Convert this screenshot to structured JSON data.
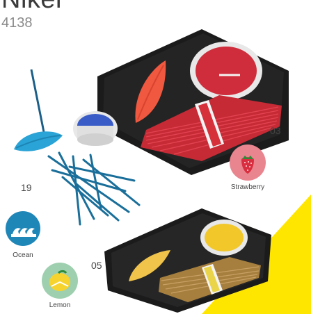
{
  "header": {
    "title": "Nikel",
    "code": "4138"
  },
  "variants": [
    {
      "number": "03",
      "label": "Strawberry",
      "icon": "strawberry-icon",
      "color": "#e25a6a"
    },
    {
      "number": "19",
      "label": "Ocean",
      "icon": "ocean-waves-icon",
      "color": "#1f86b8"
    },
    {
      "number": "05",
      "label": "Lemon",
      "icon": "lemon-icon",
      "color": "#f1d33a"
    }
  ],
  "colors": {
    "accent_yellow": "#ffe600",
    "box_black": "#1b1b1b",
    "red_stick": "#d8303a",
    "blue_stick": "#1a6f9a",
    "lemon_stick": "#b28a45"
  }
}
